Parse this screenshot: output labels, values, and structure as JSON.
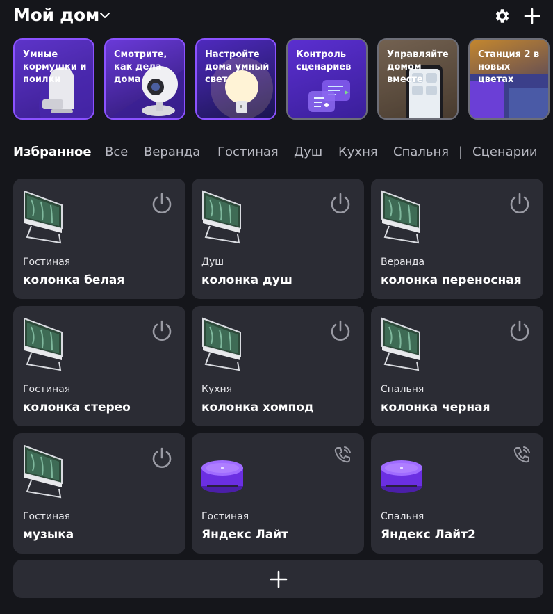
{
  "header": {
    "title": "Мой дом",
    "chevron_icon": "chevron-down-icon",
    "settings_icon": "gear-icon",
    "add_icon": "plus-icon"
  },
  "stories": [
    {
      "label": "Умные кормушки и поилки"
    },
    {
      "label": "Смотрите, как дела дома"
    },
    {
      "label": "Настройте дома умный свет"
    },
    {
      "label": "Контроль сценариев"
    },
    {
      "label": "Управляйте домом вместе"
    },
    {
      "label": "Станция 2 в новых цветах"
    }
  ],
  "tabs": [
    {
      "label": "Избранное",
      "active": true
    },
    {
      "label": "Все"
    },
    {
      "label": "Веранда"
    },
    {
      "label": "Гостиная"
    },
    {
      "label": "Душ"
    },
    {
      "label": "Кухня"
    },
    {
      "label": "Спальня"
    },
    {
      "label": "|"
    },
    {
      "label": "Сценарии"
    }
  ],
  "devices": [
    {
      "room": "Гостиная",
      "name": "колонка белая",
      "type": "tv",
      "action_icon": "power-icon"
    },
    {
      "room": "Душ",
      "name": "колонка душ",
      "type": "tv",
      "action_icon": "power-icon"
    },
    {
      "room": "Веранда",
      "name": "колонка переносная",
      "type": "tv",
      "action_icon": "power-icon"
    },
    {
      "room": "Гостиная",
      "name": "колонка стерео",
      "type": "tv",
      "action_icon": "power-icon"
    },
    {
      "room": "Кухня",
      "name": "колонка хомпод",
      "type": "tv",
      "action_icon": "power-icon"
    },
    {
      "room": "Спальня",
      "name": "колонка черная",
      "type": "tv",
      "action_icon": "power-icon"
    },
    {
      "room": "Гостиная",
      "name": "музыка",
      "type": "tv",
      "action_icon": "power-icon"
    },
    {
      "room": "Гостиная",
      "name": "Яндекс Лайт",
      "type": "speaker",
      "action_icon": "phone-call-icon"
    },
    {
      "room": "Спальня",
      "name": "Яндекс Лайт2",
      "type": "speaker",
      "action_icon": "phone-call-icon"
    }
  ],
  "add_device": {
    "icon": "plus-icon"
  },
  "colors": {
    "background": "#15161b",
    "card": "#2b2c34",
    "accent_purple": "#7b3ff2",
    "tab_inactive": "#b7b8c1"
  }
}
